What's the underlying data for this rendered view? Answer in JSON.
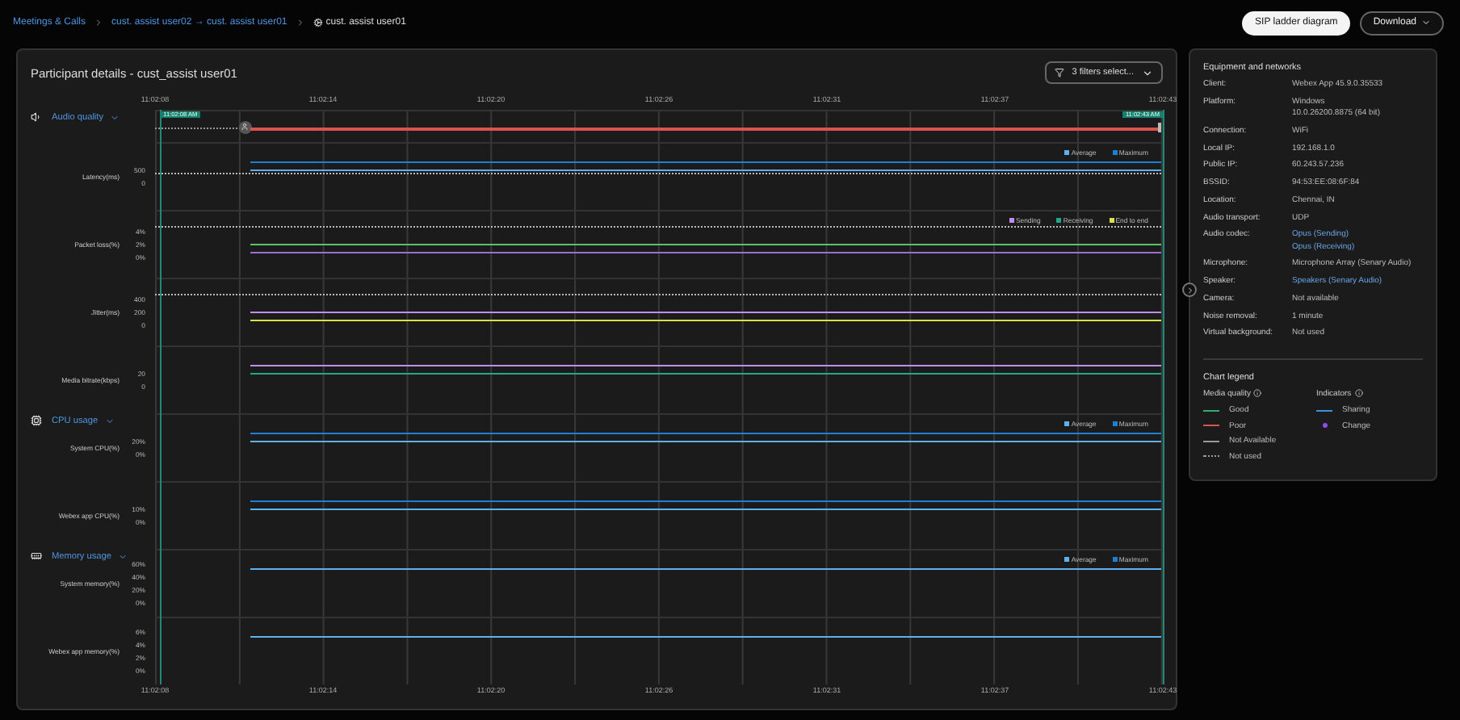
{
  "breadcrumbs": [
    {
      "label": "Meetings & Calls",
      "current": false
    },
    {
      "label": "cust. assist user02 → cust. assist user01",
      "current": false
    },
    {
      "label": "cust. assist user01",
      "current": true
    }
  ],
  "actions": [
    {
      "label": "SIP ladder diagram",
      "kind": "primary"
    },
    {
      "label": "Download",
      "kind": "menu"
    }
  ],
  "panel": {
    "title": "Participant details - cust_assist user01",
    "filter": "3 filters select..."
  },
  "top_axis": [
    "11:02:08",
    "11:02:14",
    "11:02:20",
    "11:02:26",
    "11:02:31",
    "11:02:37",
    "11:02:43"
  ],
  "bottom_axis": [
    "11:02:08",
    "11:02:14",
    "11:02:20",
    "11:02:26",
    "11:02:31",
    "11:02:37",
    "11:02:43"
  ],
  "markers": [
    {
      "label": "11:02:08 AM"
    },
    {
      "label": "11:02:43 AM"
    }
  ],
  "sections": [
    {
      "title": "Audio quality",
      "expanded": true,
      "status_line": {
        "color": "#d9534f"
      },
      "metrics": [
        {
          "label": "Latency(ms)",
          "ticks": [
            "500",
            "0"
          ],
          "legend": [
            {
              "label": "Average",
              "color": "#5fb0ef"
            },
            {
              "label": "Maximum",
              "color": "#1f7fd6"
            }
          ],
          "lines": [
            {
              "kind": "solid",
              "color": "#1f7fd6"
            },
            {
              "kind": "solid",
              "color": "#5fb0ef"
            },
            {
              "kind": "threshold"
            }
          ]
        },
        {
          "label": "Packet loss(%)",
          "ticks": [
            "4%",
            "2%",
            "0%"
          ],
          "legend": [
            {
              "label": "Sending",
              "color": "#c08ef0"
            },
            {
              "label": "Receiving",
              "color": "#1fa88a"
            },
            {
              "label": "End to end",
              "color": "#d8e04a"
            }
          ],
          "lines": [
            {
              "kind": "threshold"
            },
            {
              "kind": "solid",
              "color": "#5cc26a"
            },
            {
              "kind": "solid",
              "color": "#9a6fd0"
            }
          ]
        },
        {
          "label": "Jitter(ms)",
          "ticks": [
            "400",
            "200",
            "0"
          ],
          "lines": [
            {
              "kind": "threshold"
            },
            {
              "kind": "solid",
              "color": "#c08ef0"
            },
            {
              "kind": "solid",
              "color": "#d8e04a"
            }
          ]
        },
        {
          "label": "Media bitrate(kbps)",
          "ticks": [
            "20",
            "0"
          ],
          "lines": [
            {
              "kind": "solid",
              "color": "#c08ef0"
            },
            {
              "kind": "solid",
              "color": "#1fa88a"
            }
          ]
        }
      ]
    },
    {
      "title": "CPU usage",
      "expanded": true,
      "metrics": [
        {
          "label": "System CPU(%)",
          "ticks": [
            "20%",
            "0%"
          ],
          "legend": [
            {
              "label": "Average",
              "color": "#5fb0ef"
            },
            {
              "label": "Maximum",
              "color": "#1f7fd6"
            }
          ],
          "lines": [
            {
              "kind": "solid",
              "color": "#1f7fd6"
            },
            {
              "kind": "solid",
              "color": "#5fb0ef"
            }
          ]
        },
        {
          "label": "Webex app CPU(%)",
          "ticks": [
            "10%",
            "0%"
          ],
          "lines": [
            {
              "kind": "solid",
              "color": "#1f7fd6"
            },
            {
              "kind": "solid",
              "color": "#5fb0ef"
            }
          ]
        }
      ]
    },
    {
      "title": "Memory usage",
      "expanded": true,
      "metrics": [
        {
          "label": "System memory(%)",
          "ticks": [
            "60%",
            "40%",
            "20%",
            "0%"
          ],
          "legend": [
            {
              "label": "Average",
              "color": "#5fb0ef"
            },
            {
              "label": "Maximum",
              "color": "#1f7fd6"
            }
          ],
          "lines": [
            {
              "kind": "solid",
              "color": "#5fb0ef"
            }
          ]
        },
        {
          "label": "Webex app memory(%)",
          "ticks": [
            "6%",
            "4%",
            "2%",
            "0%"
          ],
          "lines": [
            {
              "kind": "solid",
              "color": "#5fb0ef"
            }
          ]
        }
      ]
    }
  ],
  "details": {
    "title": "Equipment and networks",
    "rows": [
      {
        "label": "Client:",
        "values": [
          "Webex App 45.9.0.35533"
        ],
        "link": false
      },
      {
        "label": "Platform:",
        "values": [
          "Windows",
          "10.0.26200.8875 (64 bit)"
        ],
        "link": false
      },
      {
        "label": "Connection:",
        "values": [
          "WiFi"
        ],
        "link": false
      },
      {
        "label": "Local IP:",
        "values": [
          "192.168.1.0"
        ],
        "link": false
      },
      {
        "label": "Public IP:",
        "values": [
          "60.243.57.236"
        ],
        "link": false
      },
      {
        "label": "BSSID:",
        "values": [
          "94:53:EE:08:6F:84"
        ],
        "link": false
      },
      {
        "label": "Location:",
        "values": [
          "Chennai, IN"
        ],
        "link": false
      },
      {
        "label": "Audio transport:",
        "values": [
          "UDP"
        ],
        "link": false
      },
      {
        "label": "Audio codec:",
        "values": [
          "Opus (Sending)",
          "Opus (Receiving)"
        ],
        "link": true
      },
      {
        "label": "Microphone:",
        "values": [
          "Microphone Array (Senary Audio)"
        ],
        "link": false
      },
      {
        "label": "Speaker:",
        "values": [
          "Speakers (Senary Audio)"
        ],
        "link": true
      },
      {
        "label": "Camera:",
        "values": [
          "Not available"
        ],
        "link": false
      },
      {
        "label": "Noise removal:",
        "values": [
          "1 minute"
        ],
        "link": false
      },
      {
        "label": "Virtual background:",
        "values": [
          "Not used"
        ],
        "link": false
      }
    ]
  },
  "chart_legend": {
    "title": "Chart legend",
    "groups": [
      {
        "title": "Media quality",
        "items": [
          {
            "label": "Good",
            "kind": "line",
            "color": "#2fae6e"
          },
          {
            "label": "Poor",
            "kind": "line",
            "color": "#d9534f"
          },
          {
            "label": "Not Available",
            "kind": "line",
            "color": "#9a9a9a"
          },
          {
            "label": "Not used",
            "kind": "dotted",
            "color": "#9a9a9a"
          }
        ]
      },
      {
        "title": "Indicators",
        "items": [
          {
            "label": "Sharing",
            "kind": "line",
            "color": "#3f8fe0"
          },
          {
            "label": "Change",
            "kind": "dot",
            "color": "#8a4fe8"
          }
        ]
      }
    ]
  }
}
